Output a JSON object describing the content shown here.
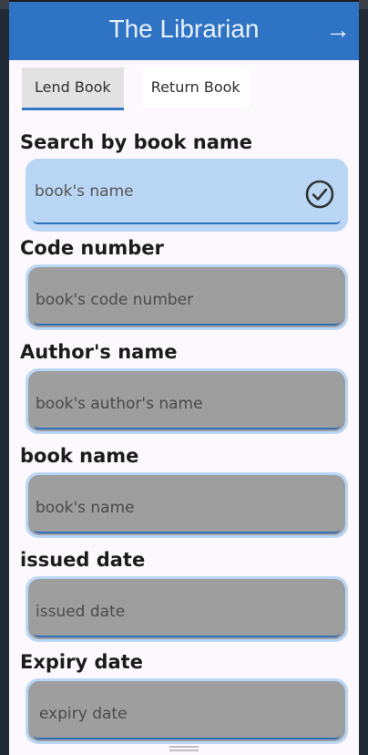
{
  "app": {
    "title": "The Librarian"
  },
  "tabs": [
    {
      "label": "Lend Book",
      "active": true
    },
    {
      "label": "Return Book",
      "active": false
    }
  ],
  "form": {
    "search": {
      "label": "Search by book name",
      "placeholder": "book's name"
    },
    "code": {
      "label": "Code number",
      "placeholder": "book's code number"
    },
    "author": {
      "label": "Author's name",
      "placeholder": "book's author's name"
    },
    "book": {
      "label": "book name",
      "placeholder": "book's name"
    },
    "issued": {
      "label": "issued date",
      "placeholder": "issued date"
    },
    "expiry": {
      "label": "Expiry date",
      "placeholder": "expiry date"
    }
  },
  "icons": {
    "forward": "arrow-forward-icon",
    "confirm": "check-circle-icon"
  },
  "colors": {
    "appbar": "#2f73c4",
    "tab_indicator": "#3176c8",
    "field_highlight": "#b9d7f5",
    "field_disabled": "#9e9e9e"
  }
}
